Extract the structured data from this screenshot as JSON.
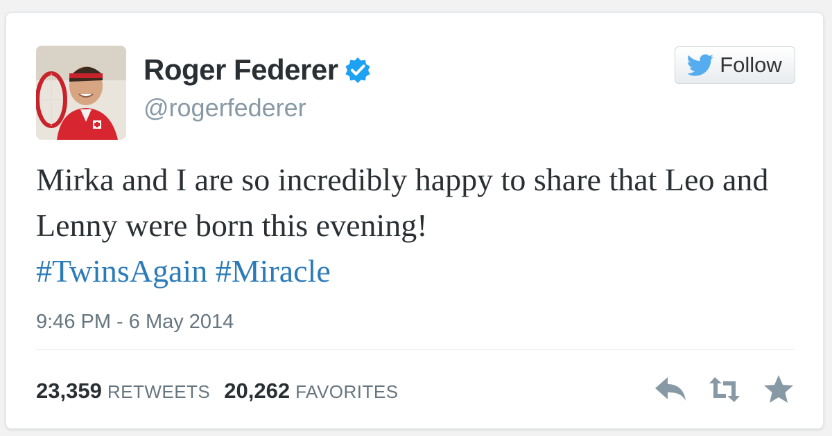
{
  "user": {
    "name": "Roger Federer",
    "handle": "@rogerfederer"
  },
  "follow": {
    "label": "Follow"
  },
  "tweet": {
    "text": "Mirka and I are so incredibly happy to share that Leo and Lenny were born this evening!",
    "hashtags": [
      "#TwinsAgain",
      "#Miracle"
    ],
    "timestamp": "9:46 PM - 6 May 2014"
  },
  "stats": {
    "retweets_count": "23,359",
    "retweets_label": "RETWEETS",
    "favorites_count": "20,262",
    "favorites_label": "FAVORITES"
  },
  "icons": {
    "verified": "verified-badge-icon",
    "follow": "twitter-bird-icon",
    "reply": "reply-icon",
    "retweet": "retweet-icon",
    "favorite": "star-icon"
  },
  "colors": {
    "hashtag": "#2b7bb9",
    "verified": "#1da1f2",
    "bird": "#55acee"
  }
}
